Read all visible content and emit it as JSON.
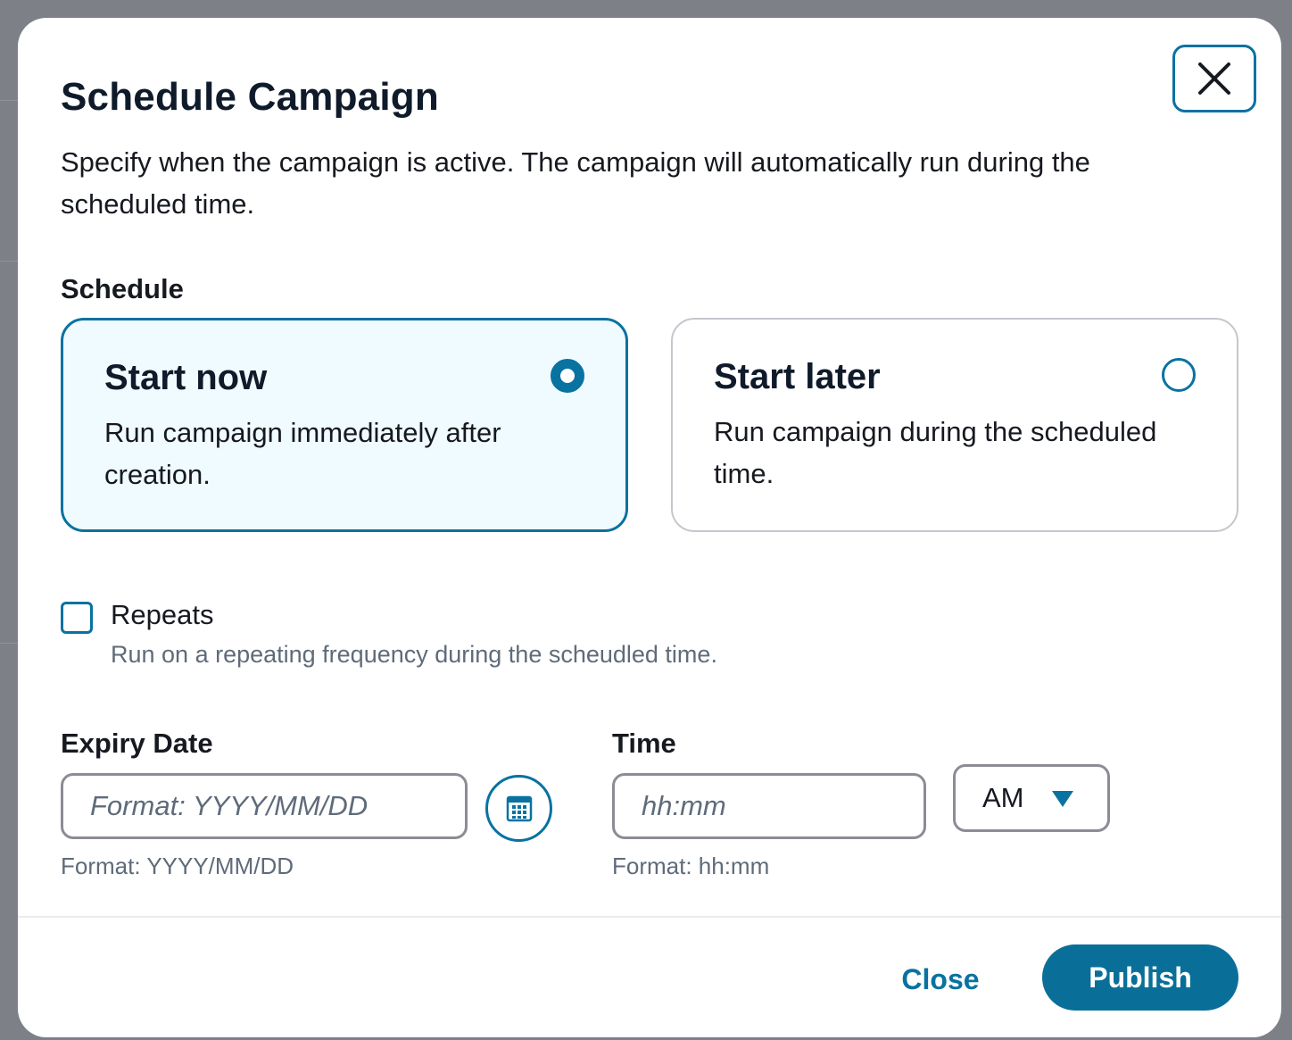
{
  "dialog": {
    "title": "Schedule Campaign",
    "description": "Specify when the campaign is active. The campaign will automatically run during the scheduled time."
  },
  "schedule": {
    "label": "Schedule",
    "options": [
      {
        "title": "Start now",
        "description": "Run campaign immediately after creation.",
        "selected": true
      },
      {
        "title": "Start later",
        "description": "Run campaign during the scheduled time.",
        "selected": false
      }
    ]
  },
  "repeats": {
    "label": "Repeats",
    "description": "Run on a repeating frequency during the scheudled time.",
    "checked": false
  },
  "expiry_date": {
    "label": "Expiry Date",
    "value": "",
    "placeholder": "Format: YYYY/MM/DD",
    "hint": "Format: YYYY/MM/DD",
    "calendar_icon": "calendar-icon"
  },
  "time": {
    "label": "Time",
    "value": "",
    "placeholder": "hh:mm",
    "hint": "Format: hh:mm",
    "period": "AM"
  },
  "footer": {
    "close_label": "Close",
    "publish_label": "Publish"
  },
  "colors": {
    "accent": "#0972a1",
    "selected_tile_bg": "#f0fbff",
    "publish_bg": "#0a6f98"
  }
}
